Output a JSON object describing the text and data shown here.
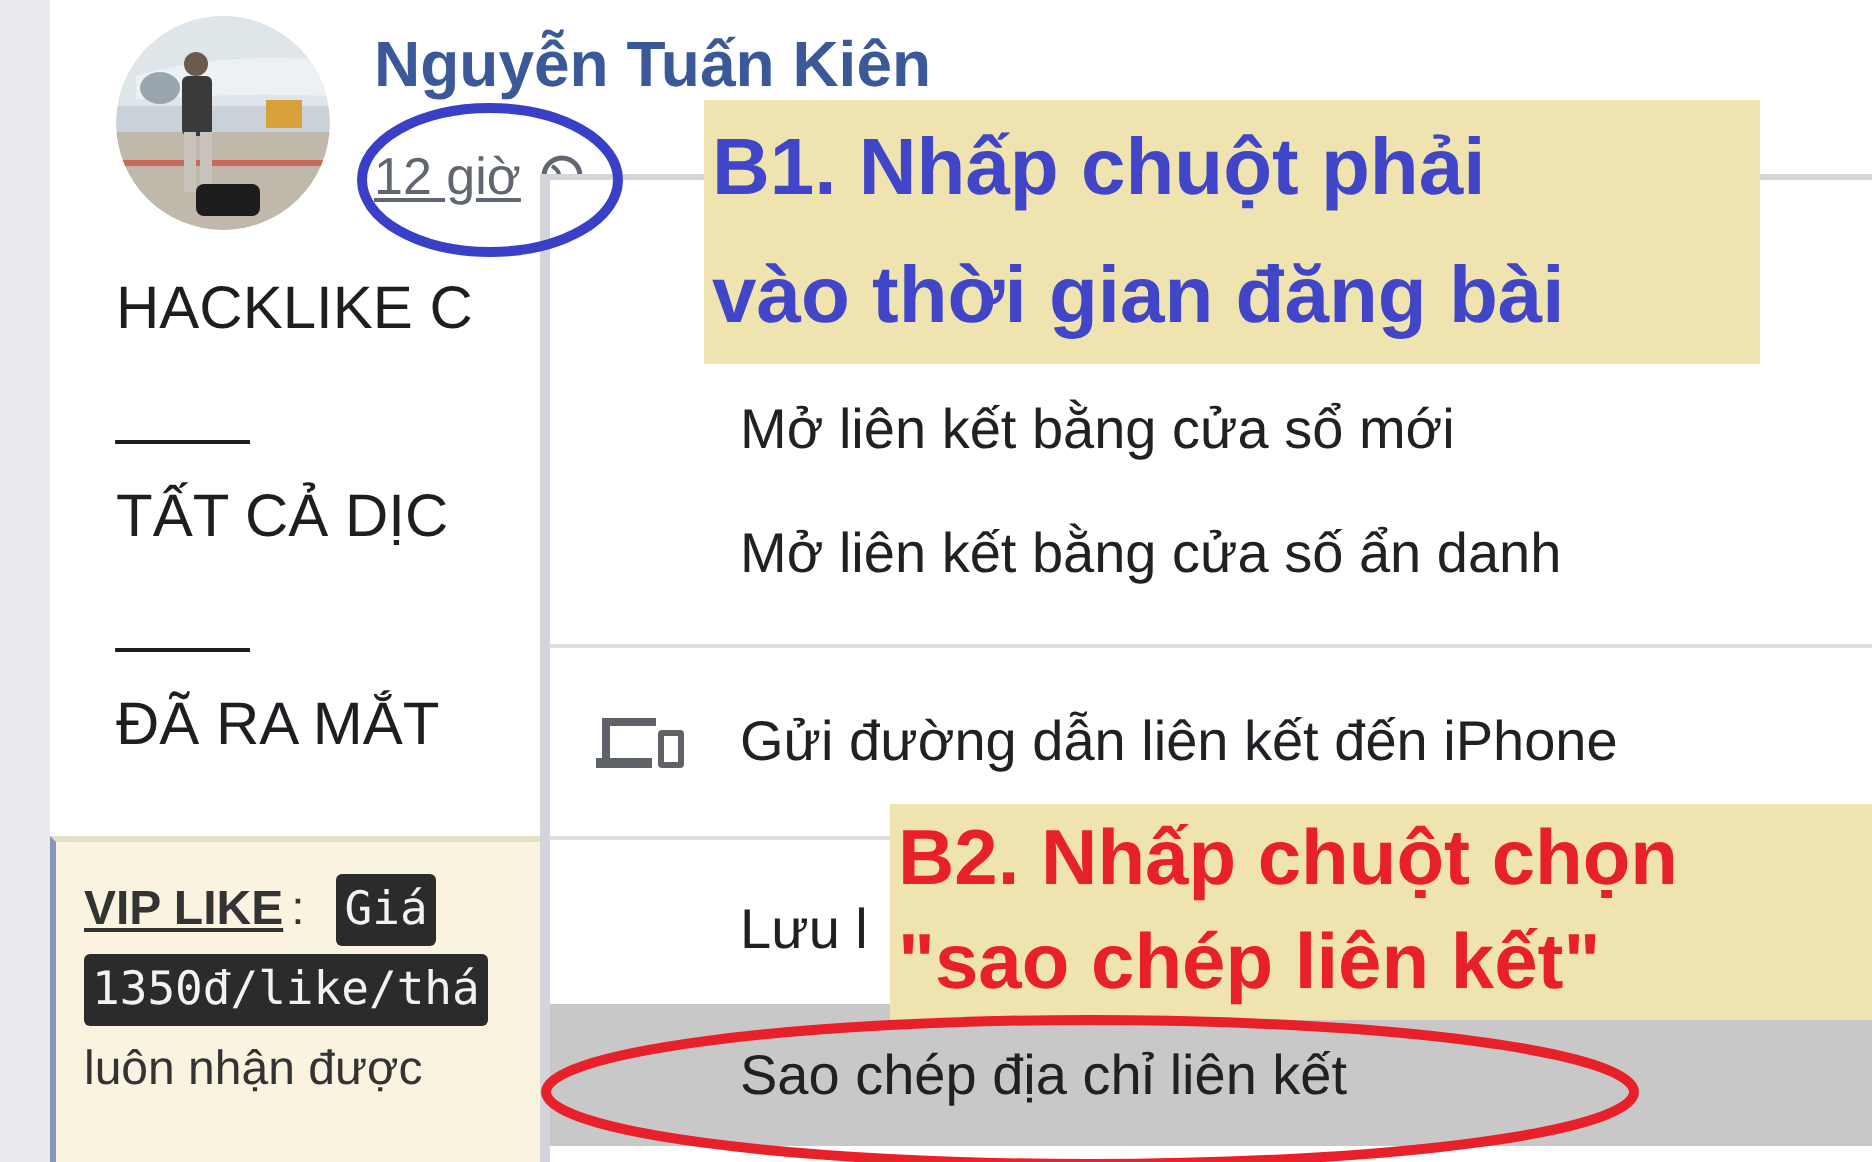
{
  "post": {
    "author": "Nguyễn Tuấn Kiên",
    "time": "12 giờ",
    "lines": [
      {
        "text": "HACKLIKE C"
      },
      {
        "text": "____"
      },
      {
        "text": "TẤT CẢ DỊC"
      },
      {
        "text": "____"
      },
      {
        "text": "ĐÃ RA MẮT"
      }
    ],
    "promo": {
      "title": "VIP LIKE",
      "colon": ":",
      "code_1": "Giá",
      "code_2": "1350đ/like/thá",
      "text": "luôn nhận được"
    }
  },
  "context_menu": {
    "items": [
      {
        "kind": "item",
        "label": "Mở liên kết bằng cửa sổ mới",
        "selected": false
      },
      {
        "kind": "item",
        "label": "Mở liên kết bằng cửa số ẩn danh",
        "selected": false
      },
      {
        "kind": "divider"
      },
      {
        "kind": "device_item",
        "label": "Gửi đường dẫn liên kết đến iPhone",
        "selected": false
      },
      {
        "kind": "divider"
      },
      {
        "kind": "item",
        "label": "Lưu l",
        "selected": false
      },
      {
        "kind": "item",
        "label": "Sao chép địa chỉ liên kết",
        "selected": true
      }
    ]
  },
  "annotations": [
    {
      "lines": [
        "B1. Nhấp chuột phải",
        "vào thời gian đăng bài"
      ],
      "color": "#4146c9"
    },
    {
      "lines": [
        "B2. Nhấp chuột chọn",
        "\"sao chép liên kết\""
      ],
      "color": "#e8202a"
    }
  ],
  "circle_marks": [
    {
      "color": "#3a3fc8"
    },
    {
      "color": "#e8202a"
    }
  ]
}
